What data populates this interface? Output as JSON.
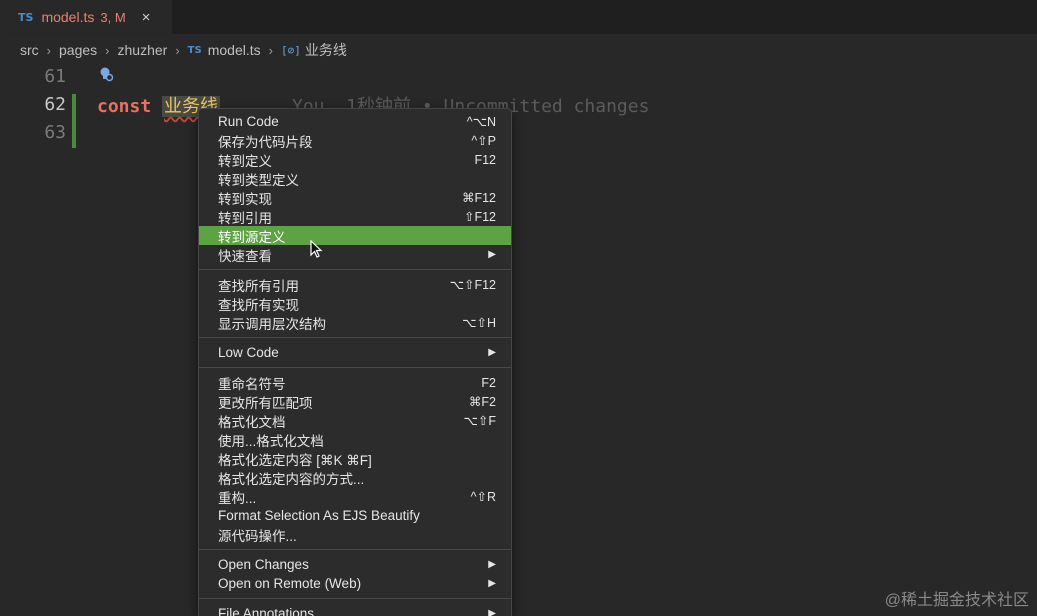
{
  "tab": {
    "icon": "TS",
    "name": "model.ts",
    "status": "3, M",
    "close": "×"
  },
  "breadcrumb": {
    "items": [
      "src",
      "pages",
      "zhuzher"
    ],
    "file_icon": "TS",
    "file": "model.ts",
    "symbol_icon": "[⊘]",
    "symbol": "业务线"
  },
  "editor": {
    "lines": [
      "61",
      "62",
      "63"
    ],
    "code_keyword": "const",
    "code_identifier": "业务线",
    "blame": "You, 1秒钟前 • Uncommitted changes"
  },
  "menu": {
    "groups": [
      [
        {
          "label": "Run Code",
          "shortcut": "^⌥N"
        },
        {
          "label": "保存为代码片段",
          "shortcut": "^⇧P"
        },
        {
          "label": "转到定义",
          "shortcut": "F12"
        },
        {
          "label": "转到类型定义",
          "shortcut": ""
        },
        {
          "label": "转到实现",
          "shortcut": "⌘F12"
        },
        {
          "label": "转到引用",
          "shortcut": "⇧F12"
        },
        {
          "label": "转到源定义",
          "shortcut": ""
        },
        {
          "label": "快速查看",
          "shortcut": "▶"
        }
      ],
      [
        {
          "label": "查找所有引用",
          "shortcut": "⌥⇧F12"
        },
        {
          "label": "查找所有实现",
          "shortcut": ""
        },
        {
          "label": "显示调用层次结构",
          "shortcut": "⌥⇧H"
        }
      ],
      [
        {
          "label": "Low Code",
          "shortcut": "▶"
        }
      ],
      [
        {
          "label": "重命名符号",
          "shortcut": "F2"
        },
        {
          "label": "更改所有匹配项",
          "shortcut": "⌘F2"
        },
        {
          "label": "格式化文档",
          "shortcut": "⌥⇧F"
        },
        {
          "label": "使用...格式化文档",
          "shortcut": ""
        },
        {
          "label": "格式化选定内容 [⌘K ⌘F]",
          "shortcut": ""
        },
        {
          "label": "格式化选定内容的方式...",
          "shortcut": ""
        },
        {
          "label": "重构...",
          "shortcut": "^⇧R"
        },
        {
          "label": "Format Selection As EJS Beautify",
          "shortcut": ""
        },
        {
          "label": "源代码操作...",
          "shortcut": ""
        }
      ],
      [
        {
          "label": "Open Changes",
          "shortcut": "▶"
        },
        {
          "label": "Open on Remote (Web)",
          "shortcut": "▶"
        }
      ],
      [
        {
          "label": "File Annotations",
          "shortcut": "▶"
        }
      ]
    ],
    "highlighted": "转到源定义"
  },
  "watermark": "@稀土掘金技术社区",
  "colors": {
    "highlight": "#5da243",
    "keyword": "#e9715f",
    "tab_text": "#e8826d",
    "git_added": "#4c8a3f"
  }
}
